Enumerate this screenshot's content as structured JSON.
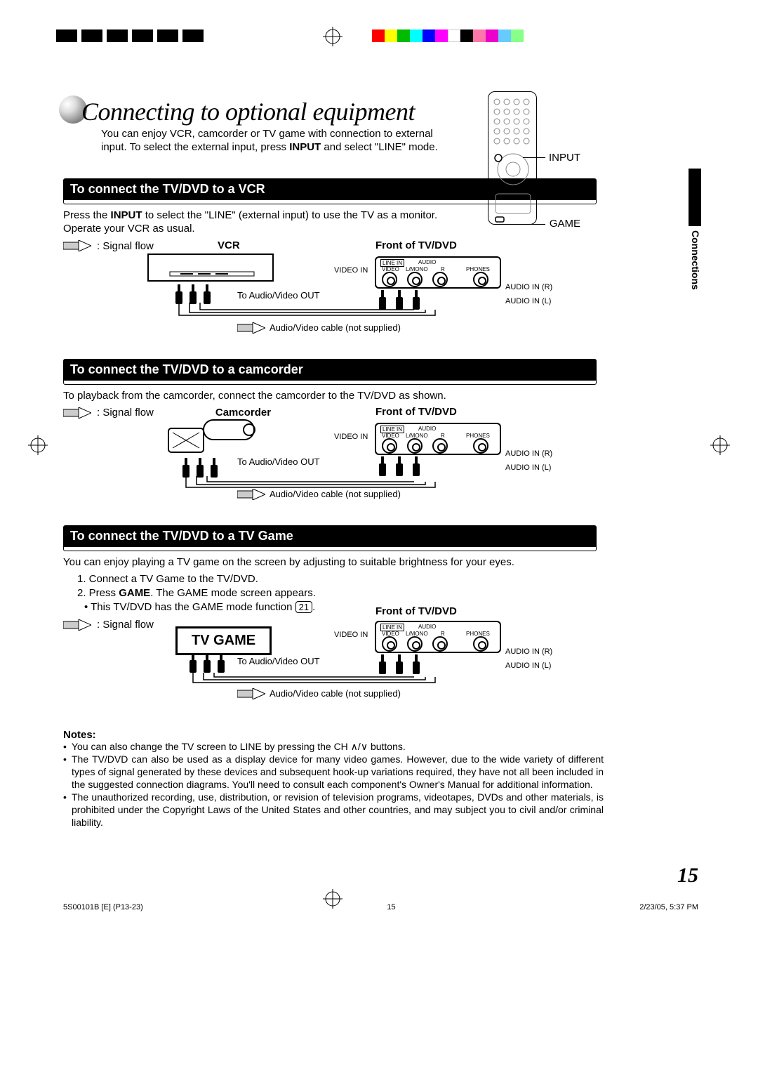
{
  "title": "Connecting to optional equipment",
  "intro_line1": "You can enjoy VCR, camcorder or TV game with connection to external",
  "intro_line2_a": "input. To select the external input, press ",
  "intro_line2_b": "INPUT",
  "intro_line2_c": " and select \"LINE\" mode.",
  "remote": {
    "input": "INPUT",
    "game": "GAME"
  },
  "side_tab": "Connections",
  "sections": {
    "vcr": {
      "heading": "To connect the TV/DVD to a VCR",
      "text_a": "Press the ",
      "text_b": "INPUT",
      "text_c": " to select the \"LINE\" (external input) to use the TV as a monitor.",
      "text2": "Operate your VCR as usual.",
      "signal_flow": ": Signal flow",
      "device": "VCR",
      "front": "Front of TV/DVD",
      "video_in": "VIDEO IN",
      "audio_r": "AUDIO IN (R)",
      "audio_l": "AUDIO IN (L)",
      "to_av_out": "To Audio/Video OUT",
      "cable": "Audio/Video cable (not supplied)",
      "tiny_line_in": "LINE IN",
      "tiny_video": "VIDEO",
      "tiny_lmono": "L/MONO",
      "tiny_audio": "AUDIO",
      "tiny_r": "R",
      "tiny_phones": "PHONES"
    },
    "cam": {
      "heading": "To connect the TV/DVD to a camcorder",
      "text": "To playback from the camcorder, connect the camcorder to the TV/DVD as shown.",
      "signal_flow": ": Signal flow",
      "device": "Camcorder",
      "front": "Front of TV/DVD",
      "video_in": "VIDEO IN",
      "audio_r": "AUDIO IN (R)",
      "audio_l": "AUDIO IN (L)",
      "to_av_out": "To Audio/Video OUT",
      "cable": "Audio/Video cable (not supplied)"
    },
    "game": {
      "heading": "To connect the TV/DVD to a TV Game",
      "text": "You can enjoy playing a TV game on the screen by adjusting to suitable brightness for your eyes.",
      "step1": "1. Connect a TV Game to the TV/DVD.",
      "step2_a": "2. Press ",
      "step2_b": "GAME",
      "step2_c": ". The GAME mode screen appears.",
      "bullet_a": "• This TV/DVD has the GAME mode function ",
      "bullet_page": "21",
      "bullet_c": ".",
      "signal_flow": ": Signal flow",
      "device": "TV GAME",
      "front": "Front of TV/DVD",
      "video_in": "VIDEO IN",
      "audio_r": "AUDIO IN (R)",
      "audio_l": "AUDIO IN (L)",
      "to_av_out": "To Audio/Video OUT",
      "cable": "Audio/Video cable (not supplied)"
    }
  },
  "notes": {
    "heading": "Notes:",
    "n1": "You can also change the TV screen to LINE by pressing the CH ∧/∨ buttons.",
    "n2": "The TV/DVD can also be used as a display device for many video games. However, due to the wide variety of different types of signal generated by these devices and subsequent hook-up variations required, they have not all been included in the suggested connection diagrams. You'll need to consult each component's Owner's Manual for additional information.",
    "n3": "The unauthorized recording, use, distribution, or revision of television programs, videotapes, DVDs and other materials, is prohibited under the Copyright Laws of the United States and other countries, and may subject you to civil and/or criminal liability."
  },
  "page_number": "15",
  "footer": {
    "left": "5S00101B [E] (P13-23)",
    "center": "15",
    "right": "2/23/05, 5:37 PM"
  }
}
